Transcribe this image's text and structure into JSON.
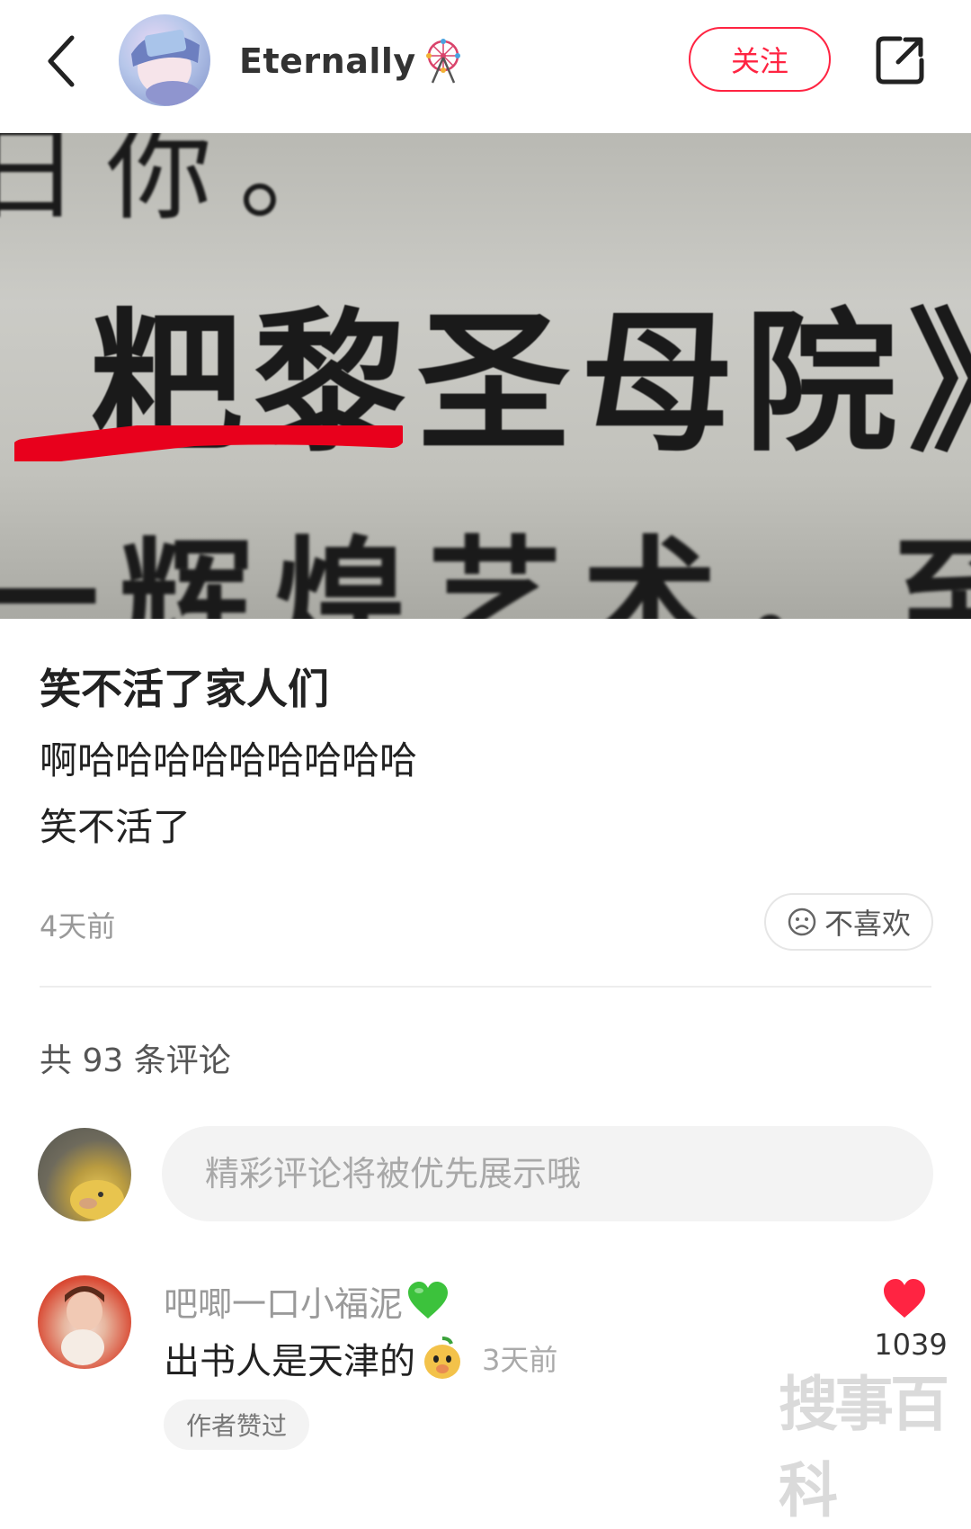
{
  "header": {
    "author_name": "Eternally",
    "follow_label": "关注"
  },
  "photo": {
    "line1": "日你。",
    "line2": "粑黎圣母院》",
    "line3": "一辉煌艺术，至"
  },
  "post": {
    "title": "笑不活了家人们",
    "body_line1": "啊哈哈哈哈哈哈哈哈哈",
    "body_line2": "笑不活了",
    "time": "4天前",
    "dislike_label": "不喜欢"
  },
  "comments": {
    "count_label": "共 93 条评论",
    "input_placeholder": "精彩评论将被优先展示哦",
    "items": [
      {
        "user": "吧唧一口小福泥",
        "text": "出书人是天津的",
        "time": "3天前",
        "likes": "1039",
        "badge": "作者赞过"
      }
    ]
  },
  "watermark": "搜事百科",
  "colors": {
    "accent": "#ff2442",
    "muted": "#999999",
    "input_bg": "#f3f3f3"
  }
}
